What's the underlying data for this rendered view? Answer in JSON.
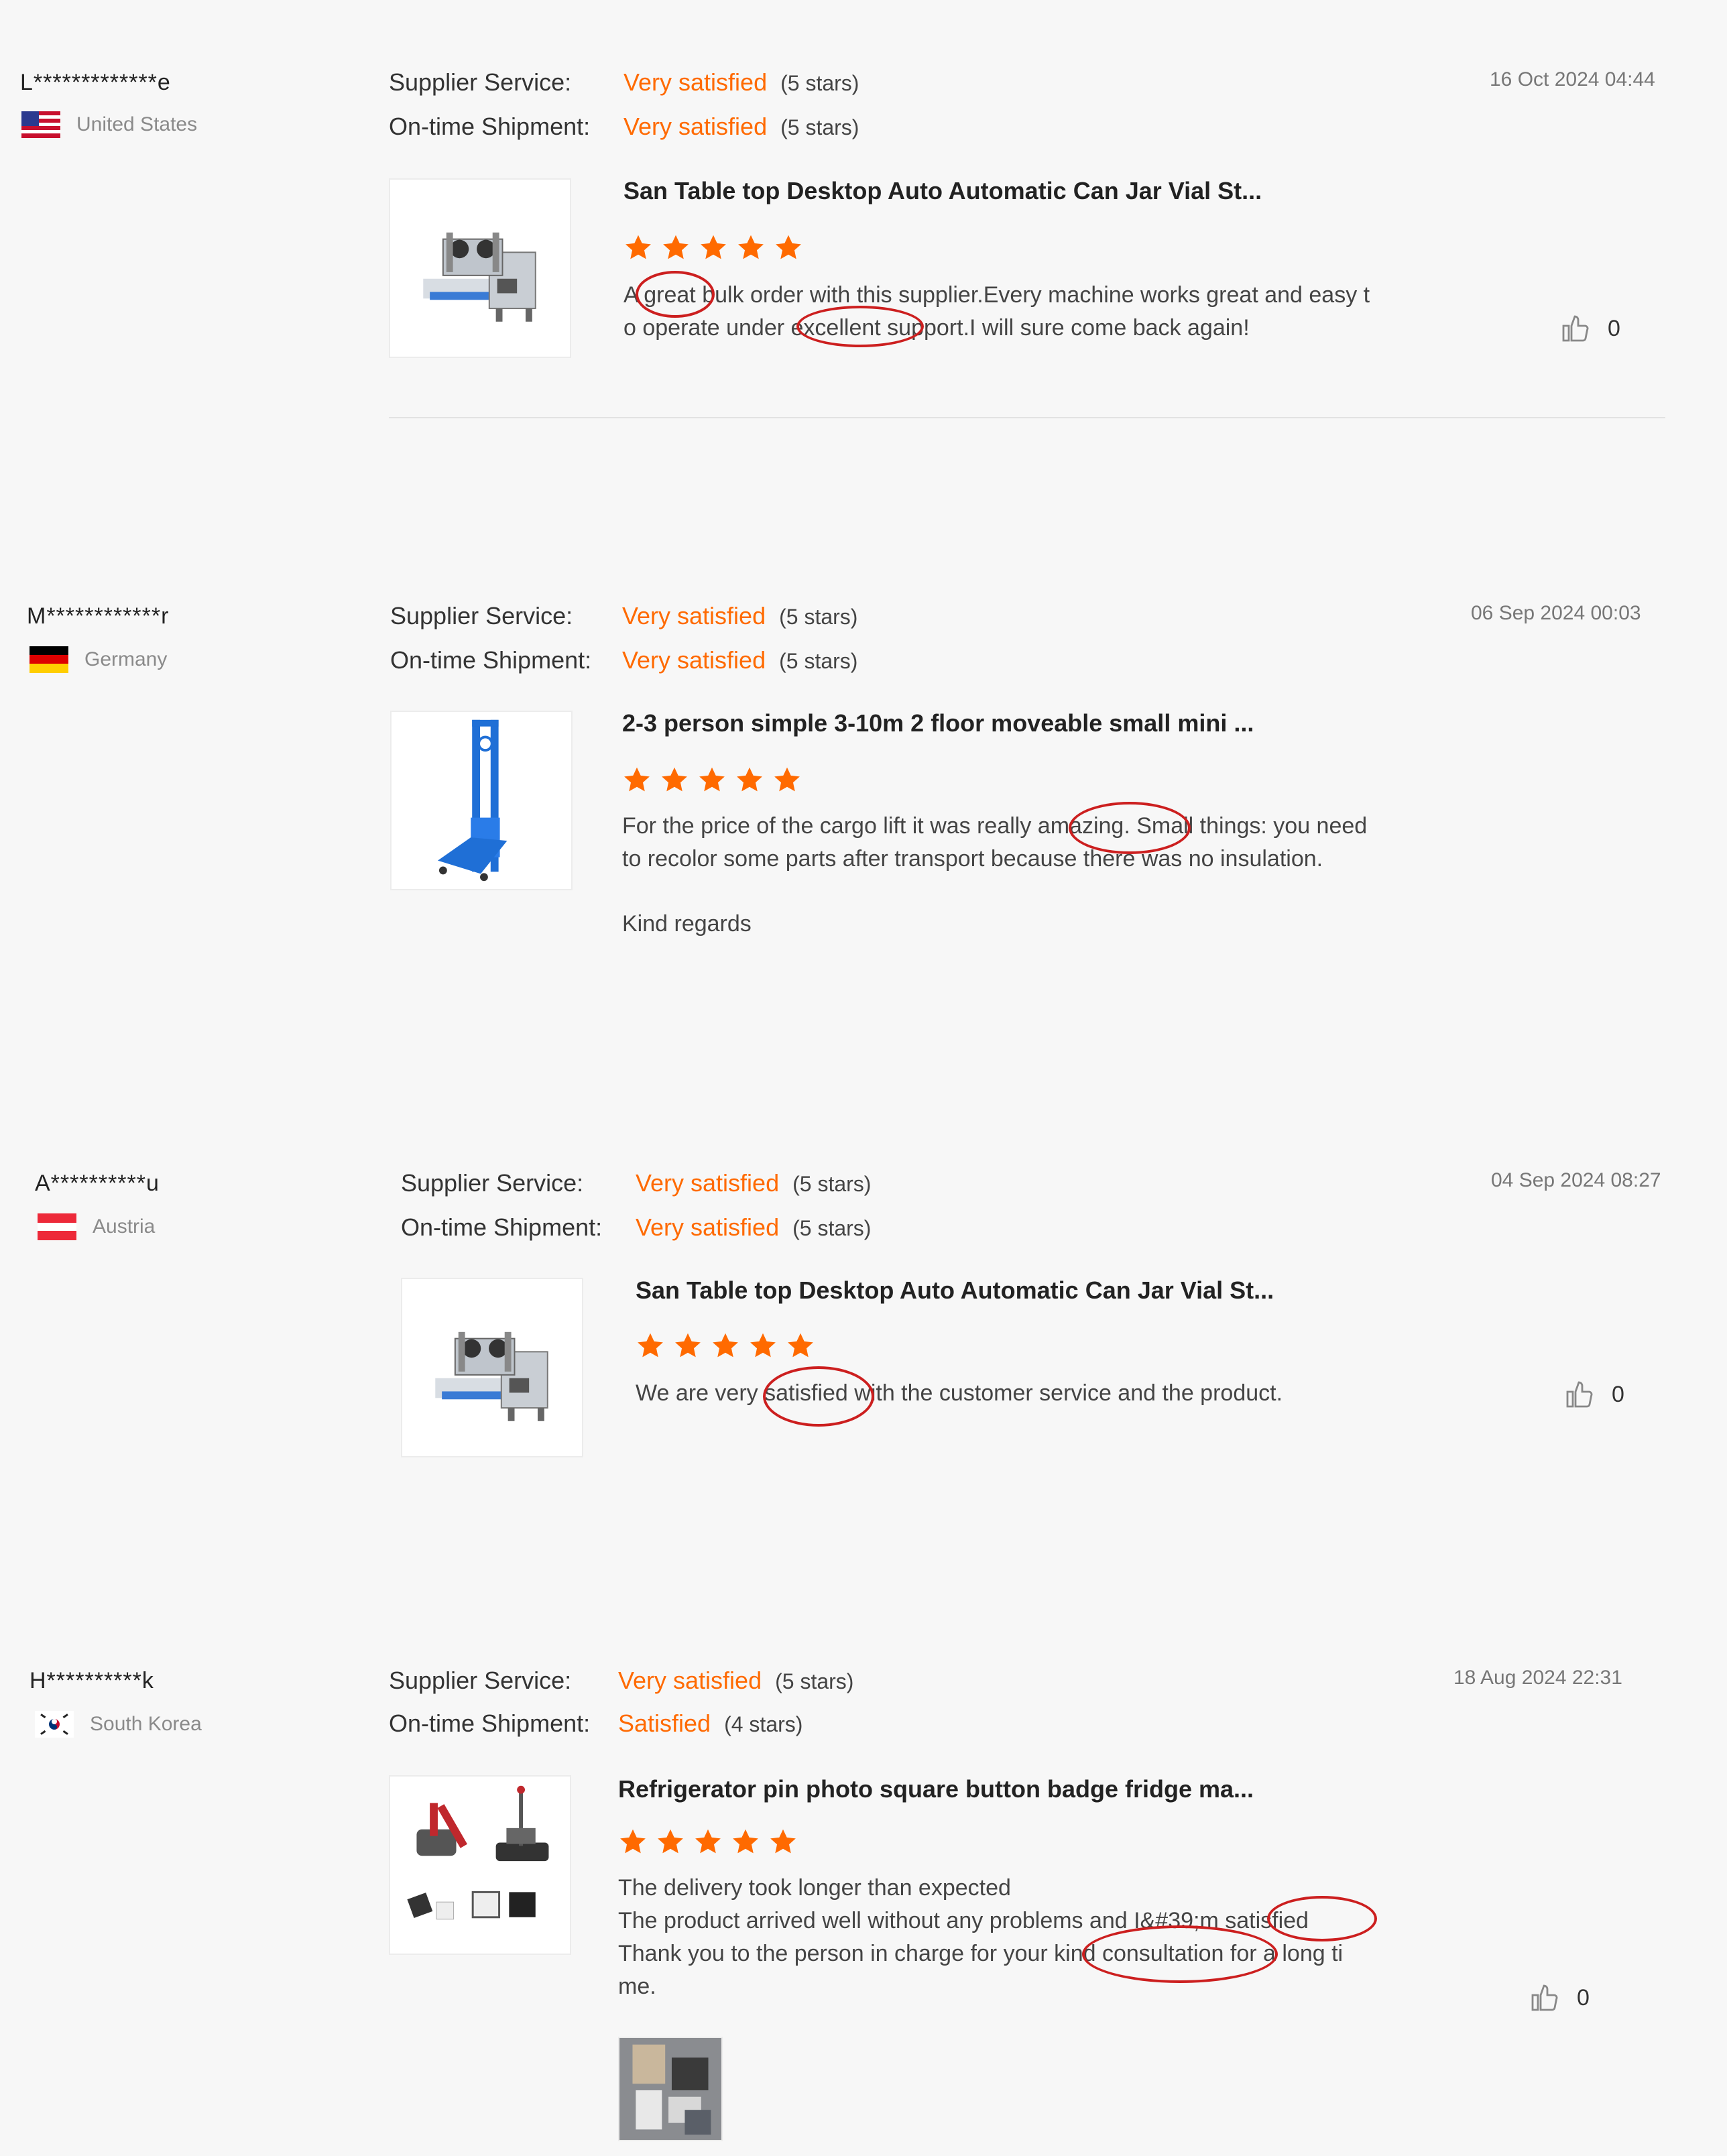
{
  "labels": {
    "supplier_service": "Supplier Service:",
    "on_time_shipment": "On-time Shipment:"
  },
  "colors": {
    "rating_orange": "#ff6a00",
    "annotation_red": "#cc1f1f"
  },
  "reviews": [
    {
      "user": "L*************e",
      "country": "United States",
      "flag_icon": "us-flag-icon",
      "date": "16 Oct 2024 04:44",
      "supplier_service": {
        "value": "Very satisfied",
        "stars": "(5 stars)"
      },
      "on_time_shipment": {
        "value": "Very satisfied",
        "stars": "(5 stars)"
      },
      "product_title": "San Table top Desktop Auto Automatic Can Jar Vial St...",
      "product_icon": "labeling-machine-icon",
      "rating": 5,
      "comment": [
        "A great bulk order with this supplier.Every machine works great and easy t",
        "o operate under excellent support.I will sure come back again!"
      ],
      "likes": "0"
    },
    {
      "user": "M************r",
      "country": "Germany",
      "flag_icon": "de-flag-icon",
      "date": "06 Sep 2024 00:03",
      "supplier_service": {
        "value": "Very satisfied",
        "stars": "(5 stars)"
      },
      "on_time_shipment": {
        "value": "Very satisfied",
        "stars": "(5 stars)"
      },
      "product_title": "2-3 person simple 3-10m 2 floor moveable small mini ...",
      "product_icon": "cargo-lift-icon",
      "rating": 5,
      "comment": [
        "For the price of the cargo lift it was really amazing. Small things: you need",
        "to recolor some parts after transport because there was no insulation."
      ],
      "comment_extra": "Kind regards"
    },
    {
      "user": "A**********u",
      "country": "Austria",
      "flag_icon": "at-flag-icon",
      "date": "04 Sep 2024 08:27",
      "supplier_service": {
        "value": "Very satisfied",
        "stars": "(5 stars)"
      },
      "on_time_shipment": {
        "value": "Very satisfied",
        "stars": "(5 stars)"
      },
      "product_title": "San Table top Desktop Auto Automatic Can Jar Vial St...",
      "product_icon": "labeling-machine-icon",
      "rating": 5,
      "comment": [
        "We are very satisfied with the customer service and the product."
      ],
      "likes": "0"
    },
    {
      "user": "H**********k",
      "country": "South Korea",
      "flag_icon": "kr-flag-icon",
      "date": "18 Aug 2024 22:31",
      "supplier_service": {
        "value": "Very satisfied",
        "stars": "(5 stars)"
      },
      "on_time_shipment": {
        "value": "Satisfied",
        "stars": "(4 stars)"
      },
      "product_title": "Refrigerator pin photo square button badge fridge ma...",
      "product_icon": "badge-press-icon",
      "rating": 5,
      "comment": [
        "The delivery took longer than expected",
        "The product arrived well without any problems and I&#39;m satisfied",
        "Thank you to the person in charge for your kind consultation for a long ti",
        "me."
      ],
      "likes": "0"
    }
  ]
}
